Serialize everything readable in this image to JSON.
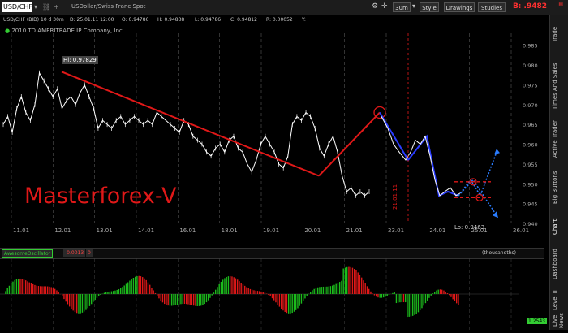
{
  "toolbar": {
    "symbol": "USD/CHF",
    "description": "USDollar/Swiss Franc Spot",
    "timeframe": "30m",
    "style_label": "Style",
    "drawings_label": "Drawings",
    "studies_label": "Studies",
    "bid_price": "B: .9482"
  },
  "info": {
    "symbol_period": "USD/CHF (BID) 10 d 30m",
    "date": "D: 25.01.11 12:00",
    "open": "O: 0.94786",
    "high": "H: 0.94838",
    "low": "L: 0.94786",
    "close": "C: 0.94812",
    "range": "R: 0.00052",
    "extra": "Y:"
  },
  "copyright": "2010 TD AMERITRADE IP Company, Inc.",
  "watermark": "Masterforex-V",
  "annotations": {
    "hi_label": "Hi: 0.97829",
    "lo_label": "Lo: 0.9463",
    "vertical_date": "21.01.11"
  },
  "right_tabs": [
    "Trade",
    "Times And Sales",
    "Active Trader",
    "Big Buttons",
    "Chart",
    "Dashboard",
    "Level II",
    "Live News"
  ],
  "oscillator": {
    "name": "AwesomeOscillator",
    "value": "-0.0013",
    "zero": "0",
    "units": "(thousandths)",
    "right_value": "1.2543"
  },
  "chart_data": {
    "type": "line",
    "x_ticks": [
      "11.01",
      "12.01",
      "13.01",
      "14.01",
      "16.01",
      "18.01",
      "19.01",
      "20.01",
      "21.01",
      "23.01",
      "24.01",
      "25.01",
      "26.01"
    ],
    "y_ticks": [
      0.985,
      0.98,
      0.975,
      0.97,
      0.965,
      0.96,
      0.955,
      0.95,
      0.945,
      0.94
    ],
    "ylim": [
      0.94,
      0.988
    ],
    "colors": {
      "price": "#ffffff",
      "trend": "#e01818",
      "wave": "#2a3cff",
      "projection": "#2a7cff",
      "osc_up": "#1cbb1c",
      "osc_down": "#e01818"
    },
    "price_series": [
      0.965,
      0.967,
      0.963,
      0.969,
      0.972,
      0.968,
      0.966,
      0.97,
      0.978,
      0.976,
      0.974,
      0.972,
      0.974,
      0.969,
      0.971,
      0.972,
      0.97,
      0.973,
      0.975,
      0.972,
      0.969,
      0.964,
      0.966,
      0.965,
      0.964,
      0.966,
      0.967,
      0.965,
      0.966,
      0.967,
      0.966,
      0.965,
      0.966,
      0.965,
      0.968,
      0.967,
      0.966,
      0.965,
      0.964,
      0.963,
      0.966,
      0.965,
      0.962,
      0.961,
      0.96,
      0.958,
      0.957,
      0.959,
      0.96,
      0.958,
      0.961,
      0.962,
      0.959,
      0.958,
      0.955,
      0.953,
      0.956,
      0.96,
      0.962,
      0.96,
      0.958,
      0.955,
      0.954,
      0.957,
      0.965,
      0.967,
      0.966,
      0.968,
      0.967,
      0.964,
      0.959,
      0.957,
      0.96,
      0.962,
      0.958,
      0.952,
      0.948,
      0.949,
      0.947,
      0.948,
      0.947,
      0.948
    ]
  }
}
